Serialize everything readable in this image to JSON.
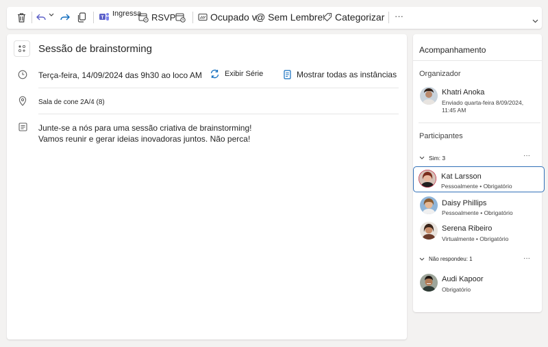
{
  "toolbar": {
    "join_label": "Ingressar",
    "rsvp_label": "RSVP",
    "status_label": "Ocupado v",
    "reminder_label": "@ Sem Lembrete",
    "categorize_label": "Categorizar",
    "more_label": "···"
  },
  "event": {
    "title": "Sessão de brainstorming",
    "datetime": "Terça-feira, 14/09/2024 das 9h30 ao loco AM",
    "view_series": "Exibir Série",
    "show_instances": "Mostrar todas as instâncias",
    "location": "Sala de cone 2A/4 (8)",
    "description_line1": "Junte-se a nós para uma sessão criativa de brainstorming!",
    "description_line2": "Vamos reunir e gerar ideias inovadoras juntos. Não perca!"
  },
  "tracking": {
    "heading": "Acompanhamento",
    "organizer_label": "Organizador",
    "organizer": {
      "name": "Khatri Anoka",
      "sent_line1": "Enviado quarta-feira 8/09/2024,",
      "sent_line2": "11:45 AM"
    },
    "participants_label": "Participantes",
    "yes_group": {
      "label": "Sim: 3",
      "people": [
        {
          "name": "Kat Larsson",
          "detail": "Pessoalmente • Obrigatório"
        },
        {
          "name": "Daisy Phillips",
          "detail": "Pessoalmente • Obrigatório"
        },
        {
          "name": "Serena Ribeiro",
          "detail": "Virtualmente • Obrigatório"
        }
      ]
    },
    "no_reply_group": {
      "label": "Não respondeu: 1",
      "people": [
        {
          "name": "Audi Kapoor",
          "detail": "Obrigatório"
        }
      ]
    },
    "more_label": "···"
  },
  "colors": {
    "accent": "#2f6fb7",
    "teams_purple": "#5b5fc7",
    "forward_blue": "#0f6cbd"
  }
}
